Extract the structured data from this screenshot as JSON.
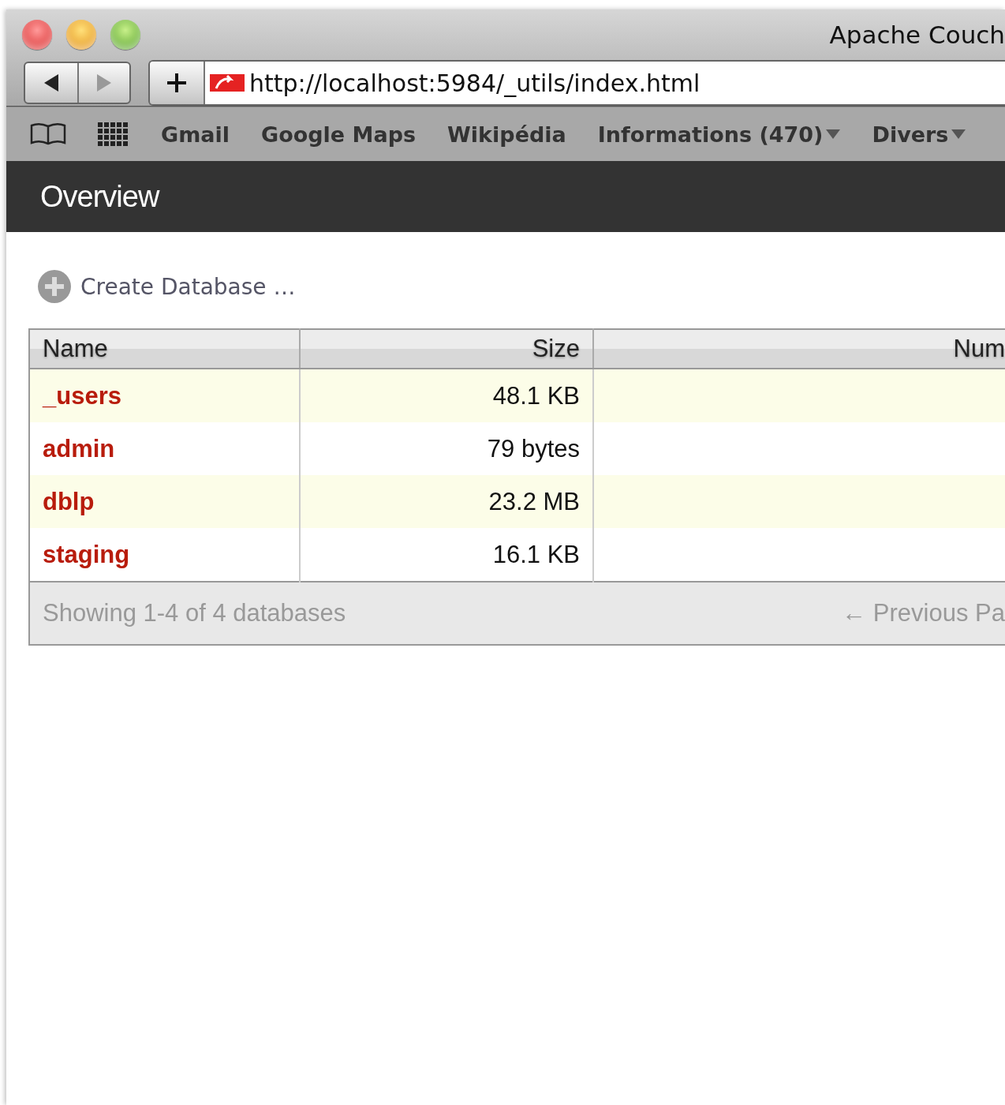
{
  "window": {
    "title": "Apache Couch"
  },
  "toolbar": {
    "back": {
      "disabled": false
    },
    "forward": {
      "disabled": true
    },
    "url": "http://localhost:5984/_utils/index.html"
  },
  "bookmarks": [
    {
      "label": "Gmail",
      "has_menu": false
    },
    {
      "label": "Google Maps",
      "has_menu": false
    },
    {
      "label": "Wikipédia",
      "has_menu": false
    },
    {
      "label": "Informations (470)",
      "has_menu": true
    },
    {
      "label": "Divers",
      "has_menu": true
    }
  ],
  "page": {
    "title": "Overview",
    "create_button": "Create Database …"
  },
  "table": {
    "columns": [
      "Name",
      "Size",
      "Num"
    ],
    "rows": [
      {
        "name": "_users",
        "size": "48.1 KB"
      },
      {
        "name": "admin",
        "size": "79 bytes"
      },
      {
        "name": "dblp",
        "size": "23.2 MB"
      },
      {
        "name": "staging",
        "size": "16.1 KB"
      }
    ],
    "footer": {
      "summary": "Showing 1-4 of 4 databases",
      "previous": "← Previous Pa"
    }
  }
}
